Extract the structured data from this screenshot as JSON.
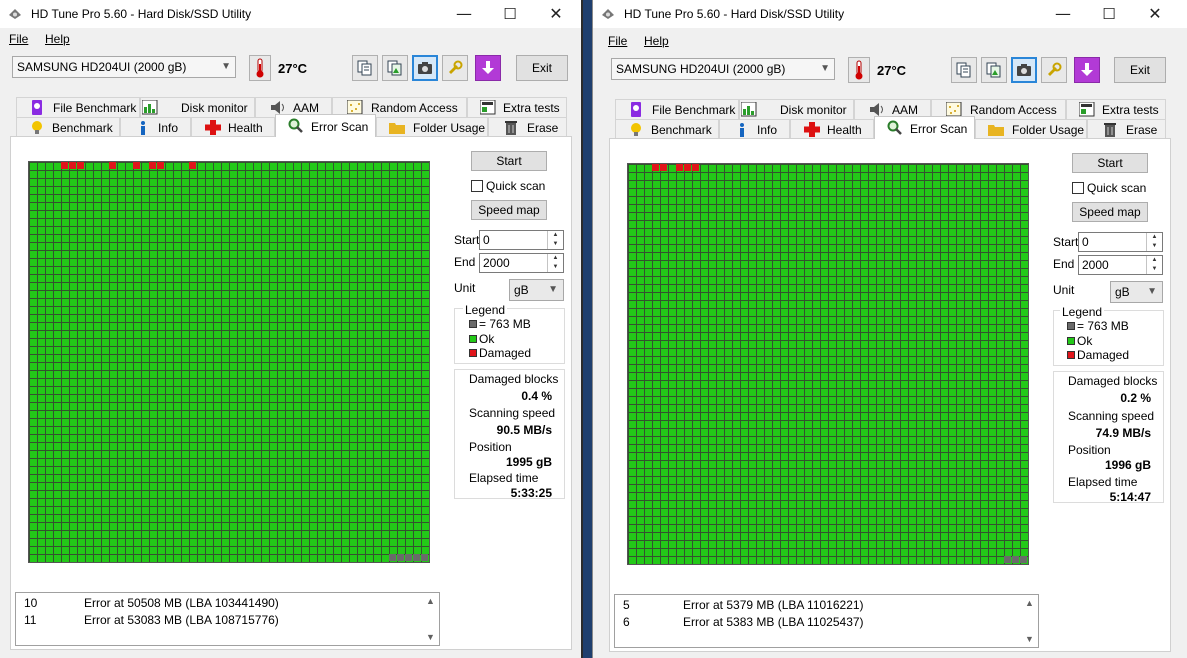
{
  "colors": {
    "ok_block": "#23c918",
    "damaged_block": "#e0151b",
    "unit_block": "#6a6a6a",
    "selected_tab_bg": "#ffffff",
    "accent": "#2a86d8"
  },
  "windows": [
    {
      "title": "HD Tune Pro 5.60 - Hard Disk/SSD Utility",
      "controls": {
        "minimize": "—",
        "maximize": "☐",
        "close": "✕"
      },
      "menu": {
        "file": "File",
        "help": "Help"
      },
      "toolbar": {
        "drive": "SAMSUNG HD204UI (2000 gB)",
        "temperature": "27°C",
        "exit": "Exit"
      },
      "tabs_row1": [
        "File Benchmark",
        "Disk monitor",
        "AAM",
        "Random Access",
        "Extra tests"
      ],
      "tabs_row2": [
        "Benchmark",
        "Info",
        "Health",
        "Error Scan",
        "Folder Usage",
        "Erase"
      ],
      "active_tab": "Error Scan",
      "scan": {
        "grid_columns": 50,
        "grid_rows": 50,
        "damaged_cells": [
          [
            0,
            4
          ],
          [
            0,
            5
          ],
          [
            0,
            6
          ],
          [
            0,
            10
          ],
          [
            0,
            13
          ],
          [
            0,
            15
          ],
          [
            0,
            16
          ],
          [
            0,
            20
          ]
        ],
        "unit_cells": [
          [
            49,
            45
          ],
          [
            49,
            46
          ],
          [
            49,
            47
          ],
          [
            49,
            48
          ],
          [
            49,
            49
          ]
        ]
      },
      "controls_panel": {
        "start_button": "Start",
        "quick_scan": "Quick scan",
        "quick_scan_checked": false,
        "speed_map_button": "Speed map",
        "start_label": "Start",
        "start_value": "0",
        "end_label": "End",
        "end_value": "2000",
        "unit_label": "Unit",
        "unit_value": "gB"
      },
      "legend": {
        "title": "Legend",
        "unit_size": "= 763 MB",
        "ok": "Ok",
        "damaged": "Damaged"
      },
      "stats": {
        "damaged_blocks_label": "Damaged blocks",
        "damaged_blocks_value": "0.4 %",
        "scanning_speed_label": "Scanning speed",
        "scanning_speed_value": "90.5 MB/s",
        "position_label": "Position",
        "position_value": "1995 gB",
        "elapsed_label": "Elapsed time",
        "elapsed_value": "5:33:25"
      },
      "log": [
        {
          "num": "10",
          "msg": "Error at 50508 MB (LBA 103441490)"
        },
        {
          "num": "11",
          "msg": "Error at 53083 MB (LBA 108715776)"
        }
      ]
    },
    {
      "title": "HD Tune Pro 5.60 - Hard Disk/SSD Utility",
      "controls": {
        "minimize": "—",
        "maximize": "☐",
        "close": "✕"
      },
      "menu": {
        "file": "File",
        "help": "Help"
      },
      "toolbar": {
        "drive": "SAMSUNG HD204UI (2000 gB)",
        "temperature": "27°C",
        "exit": "Exit"
      },
      "tabs_row1": [
        "File Benchmark",
        "Disk monitor",
        "AAM",
        "Random Access",
        "Extra tests"
      ],
      "tabs_row2": [
        "Benchmark",
        "Info",
        "Health",
        "Error Scan",
        "Folder Usage",
        "Erase"
      ],
      "active_tab": "Error Scan",
      "scan": {
        "grid_columns": 50,
        "grid_rows": 50,
        "damaged_cells": [
          [
            0,
            3
          ],
          [
            0,
            4
          ],
          [
            0,
            6
          ],
          [
            0,
            7
          ],
          [
            0,
            8
          ]
        ],
        "unit_cells": [
          [
            49,
            47
          ],
          [
            49,
            48
          ],
          [
            49,
            49
          ]
        ]
      },
      "controls_panel": {
        "start_button": "Start",
        "quick_scan": "Quick scan",
        "quick_scan_checked": false,
        "speed_map_button": "Speed map",
        "start_label": "Start",
        "start_value": "0",
        "end_label": "End",
        "end_value": "2000",
        "unit_label": "Unit",
        "unit_value": "gB"
      },
      "legend": {
        "title": "Legend",
        "unit_size": "= 763 MB",
        "ok": "Ok",
        "damaged": "Damaged"
      },
      "stats": {
        "damaged_blocks_label": "Damaged blocks",
        "damaged_blocks_value": "0.2 %",
        "scanning_speed_label": "Scanning speed",
        "scanning_speed_value": "74.9 MB/s",
        "position_label": "Position",
        "position_value": "1996 gB",
        "elapsed_label": "Elapsed time",
        "elapsed_value": "5:14:47"
      },
      "log": [
        {
          "num": "5",
          "msg": "Error at 5379 MB (LBA 11016221)"
        },
        {
          "num": "6",
          "msg": "Error at 5383 MB (LBA 11025437)"
        }
      ]
    }
  ]
}
